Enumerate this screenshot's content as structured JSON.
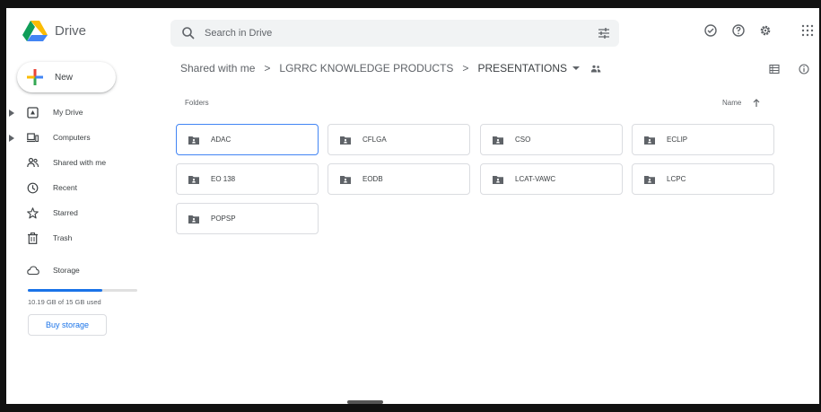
{
  "app": {
    "title": "Drive"
  },
  "search": {
    "placeholder": "Search in Drive"
  },
  "sidebar": {
    "new_label": "New",
    "items": [
      {
        "label": "My Drive",
        "icon": "my-drive-icon"
      },
      {
        "label": "Computers",
        "icon": "computers-icon"
      },
      {
        "label": "Shared with me",
        "icon": "shared-with-me-icon"
      },
      {
        "label": "Recent",
        "icon": "recent-icon"
      },
      {
        "label": "Starred",
        "icon": "star-icon"
      },
      {
        "label": "Trash",
        "icon": "trash-icon"
      }
    ],
    "storage": {
      "label": "Storage",
      "used_text": "10.19 GB of 15 GB used",
      "used_fraction": 0.68,
      "buy_label": "Buy storage"
    }
  },
  "breadcrumb": {
    "items": [
      "Shared with me",
      "LGRRC KNOWLEDGE PRODUCTS",
      "PRESENTATIONS"
    ],
    "separator": ">"
  },
  "main": {
    "section_label": "Folders",
    "sort_label": "Name",
    "folders": [
      "ADAC",
      "CFLGA",
      "CSO",
      "ECLIP",
      "EO 138",
      "EODB",
      "LCAT-VAWC",
      "LCPC",
      "POPSP"
    ],
    "selected_folder": "ADAC"
  },
  "colors": {
    "accent": "#1a73e8",
    "selected_border": "#4285f4",
    "folder_icon": "#5f6368"
  }
}
